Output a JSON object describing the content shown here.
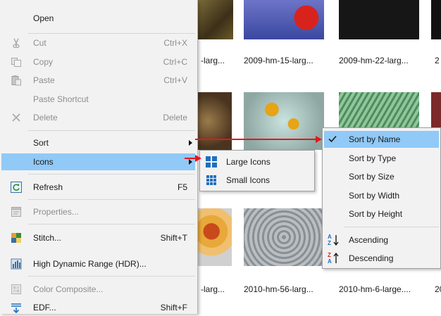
{
  "thumbnails": {
    "row1_captions": [
      "-larg...",
      "2009-hm-15-larg...",
      "2009-hm-22-larg...",
      "2"
    ],
    "row3_captions": [
      "-larg...",
      "2010-hm-56-larg...",
      "2010-hm-6-large....",
      "20"
    ]
  },
  "context_menu": {
    "open": "Open",
    "cut": "Cut",
    "cut_shortcut": "Ctrl+X",
    "copy": "Copy",
    "copy_shortcut": "Ctrl+C",
    "paste": "Paste",
    "paste_shortcut": "Ctrl+V",
    "paste_shortcut_item": "Paste Shortcut",
    "delete": "Delete",
    "delete_shortcut": "Delete",
    "sort": "Sort",
    "icons": "Icons",
    "refresh": "Refresh",
    "refresh_shortcut": "F5",
    "properties": "Properties...",
    "stitch": "Stitch...",
    "stitch_shortcut": "Shift+T",
    "hdr": "High Dynamic Range (HDR)...",
    "color_composite": "Color Composite...",
    "edf": "EDF...",
    "edf_shortcut": "Shift+F"
  },
  "icons_submenu": {
    "large_icons": "Large Icons",
    "small_icons": "Small Icons"
  },
  "sort_submenu": {
    "by_name": "Sort by Name",
    "by_type": "Sort by Type",
    "by_size": "Sort by Size",
    "by_width": "Sort by Width",
    "by_height": "Sort by Height",
    "ascending": "Ascending",
    "descending": "Descending"
  },
  "colors": {
    "highlight": "#91c9f7",
    "menu_bg": "#f2f2f2",
    "disabled_text": "#8d8d8d",
    "annotation_arrow": "#e8141e",
    "icon_blue": "#1e6fc0"
  }
}
